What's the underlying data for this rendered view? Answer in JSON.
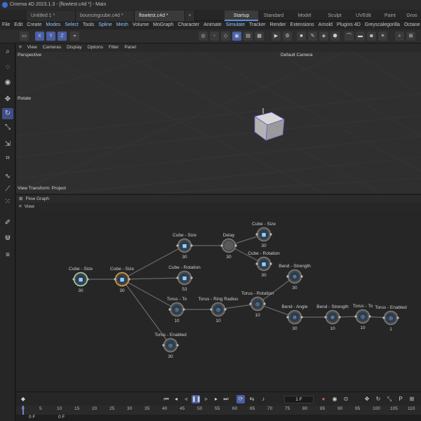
{
  "window": {
    "title": "Cinema 4D 2023.1.3 - [flowtest.c4d *] - Main"
  },
  "doc_tabs": [
    "Untitled 1 *",
    "bouncingcube.c4d *",
    "flowtest.c4d *"
  ],
  "new_tab_label": "+",
  "layout_tabs": [
    "Startup",
    "Standard",
    "Model",
    "Sculpt",
    "UVEdit",
    "Paint",
    "Groo"
  ],
  "menu": [
    "File",
    "Edit",
    "Create",
    "Modes",
    "Select",
    "Tools",
    "Spline",
    "Mesh",
    "Volume",
    "MoGraph",
    "Character",
    "Animate",
    "Simulate",
    "Tracker",
    "Render",
    "Extensions",
    "Arnold",
    "Plugins 4D",
    "Greyscalegorilla",
    "Octane",
    "Wi"
  ],
  "axis_toggles": [
    "X",
    "Y",
    "Z"
  ],
  "viewport": {
    "menu": [
      "View",
      "Cameras",
      "Display",
      "Options",
      "Filter",
      "Panel"
    ],
    "view_name": "Perspective",
    "camera": "Default Camera",
    "mode_label": "Rotate",
    "transform_label": "View Transform: Project"
  },
  "flow_graph": {
    "title": "Flow Graph",
    "menu": [
      "View"
    ],
    "nodes": [
      {
        "label": "Cube - Size",
        "value": "30",
        "icon": "cube"
      },
      {
        "label": "Cube - Size",
        "value": "30",
        "icon": "cube"
      },
      {
        "label": "Cube - Size",
        "value": "30",
        "icon": "cube"
      },
      {
        "label": "Delay",
        "value": "30",
        "icon": "none"
      },
      {
        "label": "Cube - Size",
        "value": "30",
        "icon": "cube"
      },
      {
        "label": "Cube - Rotation",
        "value": "30",
        "icon": "cube"
      },
      {
        "label": "Cube - Rotation",
        "value": "53",
        "icon": "cube"
      },
      {
        "label": "Bend - Strength",
        "value": "30",
        "icon": "bend"
      },
      {
        "label": "Torus - To",
        "value": "10",
        "icon": "torus"
      },
      {
        "label": "Torus - Ring Radius",
        "value": "10",
        "icon": "torus"
      },
      {
        "label": "Torus - Rotation",
        "value": "10",
        "icon": "torus"
      },
      {
        "label": "Bend - Angle",
        "value": "30",
        "icon": "bend"
      },
      {
        "label": "Bend - Strength",
        "value": "10",
        "icon": "bend"
      },
      {
        "label": "Torus - To",
        "value": "10",
        "icon": "torus"
      },
      {
        "label": "Torus - Enabled",
        "value": "1",
        "icon": "torus"
      },
      {
        "label": "Torus - Enabled",
        "value": "30",
        "icon": "torus"
      }
    ]
  },
  "timeline": {
    "frame_field": "1 F",
    "ticks": [
      "0",
      "5",
      "10",
      "15",
      "20",
      "25",
      "30",
      "35",
      "40",
      "45",
      "50",
      "55",
      "60",
      "65",
      "70",
      "75",
      "80",
      "85",
      "90",
      "95",
      "100",
      "105",
      "110"
    ],
    "start_field": "0 F",
    "end_field": "0 F"
  },
  "colors": {
    "accent": "#4a5fa6",
    "selected_node": "#e8a040",
    "start_node": "#9fd8b0"
  }
}
